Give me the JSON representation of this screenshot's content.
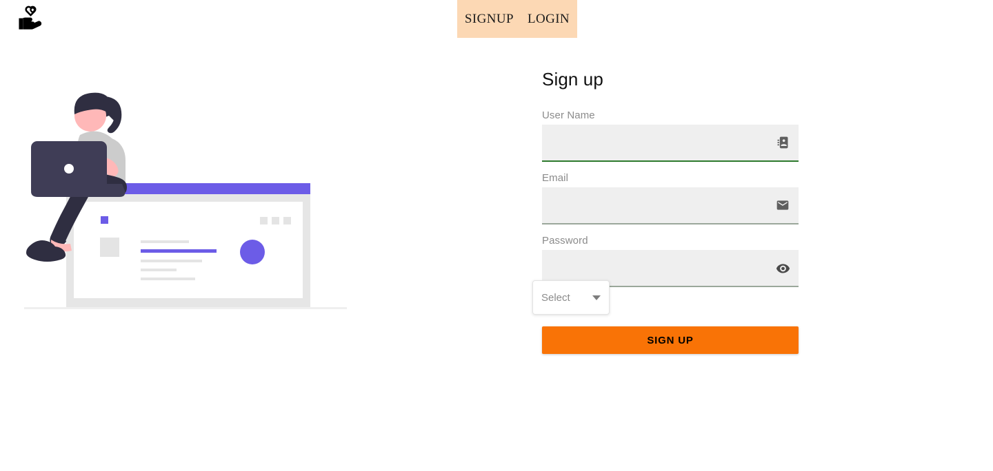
{
  "brand": {
    "logo_icon": "volunteer-hand-heart-icon"
  },
  "nav": {
    "items": [
      {
        "label": "SIGNUP",
        "name": "nav-link-signup"
      },
      {
        "label": "LOGIN",
        "name": "nav-link-login"
      }
    ],
    "background": "#fcd8b4"
  },
  "illustration": {
    "name": "woman-with-laptop-on-browser-window-illustration",
    "colors": {
      "skin": "#ffb8b8",
      "hair": "#2f2e41",
      "shirt": "#cccccc",
      "pants": "#2f2e41",
      "laptop": "#3f3d56",
      "accent": "#6c5ce7",
      "window_frame": "#e6e6e6",
      "placeholder": "#e4e4e4"
    }
  },
  "form": {
    "title": "Sign up",
    "fields": [
      {
        "label": "User Name",
        "value": "",
        "placeholder": "",
        "icon": "contact-page-icon",
        "underline_color": "#2d7a2d",
        "input_name": "username-input",
        "icon_name": "contact-page-icon"
      },
      {
        "label": "Email",
        "value": "",
        "placeholder": "",
        "icon": "email-icon",
        "underline_color": "#9aa79a",
        "input_name": "email-input",
        "icon_name": "email-icon"
      },
      {
        "label": "Password",
        "value": "",
        "placeholder": "",
        "icon": "eye-visibility-icon",
        "underline_color": "#9aa79a",
        "input_name": "password-input",
        "icon_name": "eye-visibility-icon"
      }
    ],
    "select": {
      "selected": "Select",
      "caret_icon": "chevron-down-icon"
    },
    "submit": {
      "label": "SIGN UP",
      "color": "#f97306",
      "text_color": "#000000"
    }
  }
}
